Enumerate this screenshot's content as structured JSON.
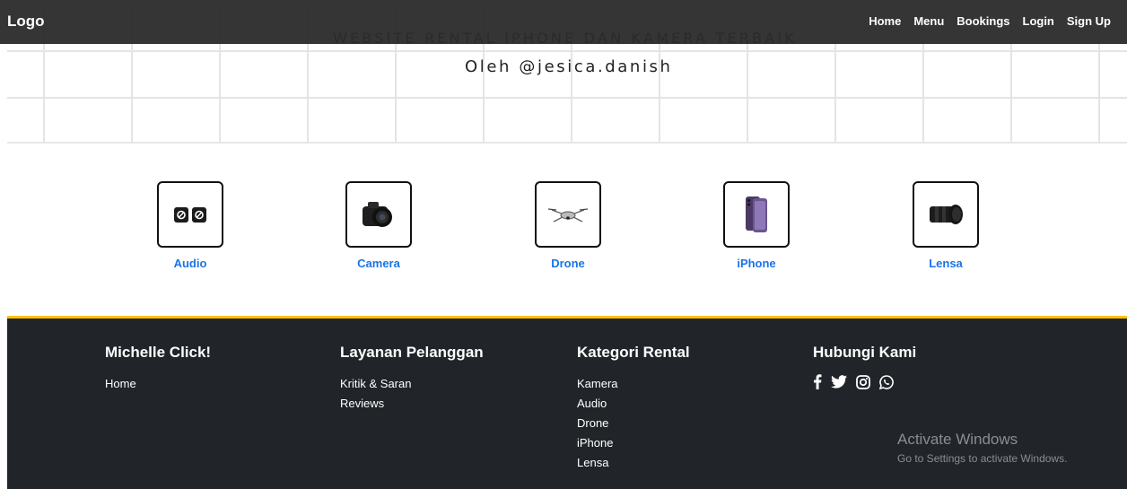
{
  "navbar": {
    "logo": "Logo",
    "links": [
      "Home",
      "Menu",
      "Bookings",
      "Login",
      "Sign Up"
    ]
  },
  "hero": {
    "title": "WEBSITE RENTAL IPHONE DAN KAMERA TERBAIK",
    "subtitle": "Oleh @jesica.danish"
  },
  "categories": [
    {
      "label": "Audio",
      "icon": "wireless-mic-icon"
    },
    {
      "label": "Camera",
      "icon": "camera-icon"
    },
    {
      "label": "Drone",
      "icon": "drone-icon"
    },
    {
      "label": "iPhone",
      "icon": "iphone-icon"
    },
    {
      "label": "Lensa",
      "icon": "lens-icon"
    }
  ],
  "footer": {
    "brand": {
      "title": "Michelle Click!",
      "links": [
        "Home"
      ]
    },
    "service": {
      "title": "Layanan Pelanggan",
      "links": [
        "Kritik & Saran",
        "Reviews"
      ]
    },
    "rental": {
      "title": "Kategori Rental",
      "links": [
        "Kamera",
        "Audio",
        "Drone",
        "iPhone",
        "Lensa"
      ]
    },
    "contact": {
      "title": "Hubungi Kami",
      "social": [
        "facebook-icon",
        "twitter-icon",
        "instagram-icon",
        "whatsapp-icon"
      ]
    }
  },
  "windows_watermark": {
    "line1": "Activate Windows",
    "line2": "Go to Settings to activate Windows."
  },
  "colors": {
    "nav_bg": "#282828",
    "category_link": "#1a73e8",
    "footer_bg": "#212529",
    "footer_accent": "#ffc107"
  }
}
